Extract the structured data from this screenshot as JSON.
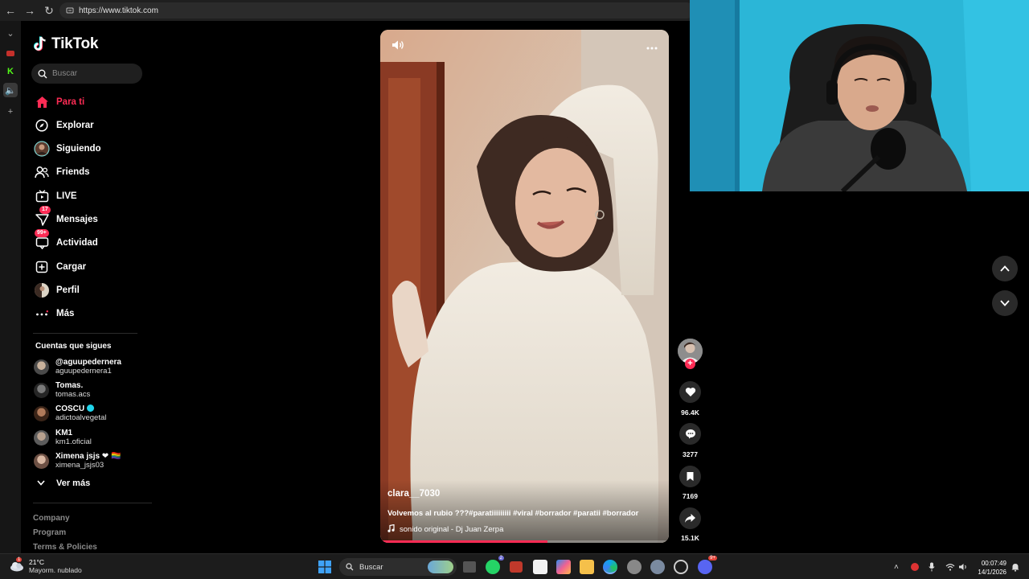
{
  "browser": {
    "url": "https://www.tiktok.com"
  },
  "sidebar": {
    "logo_text": "TikTok",
    "search_placeholder": "Buscar",
    "nav": [
      {
        "label": "Para ti",
        "icon": "home-icon",
        "active": true
      },
      {
        "label": "Explorar",
        "icon": "compass-icon"
      },
      {
        "label": "Siguiendo",
        "icon": "avatar-icon"
      },
      {
        "label": "Friends",
        "icon": "friends-icon"
      },
      {
        "label": "LIVE",
        "icon": "live-icon"
      },
      {
        "label": "Mensajes",
        "icon": "messages-icon",
        "badge": "17"
      },
      {
        "label": "Actividad",
        "icon": "activity-icon",
        "badge": "99+"
      },
      {
        "label": "Cargar",
        "icon": "upload-icon"
      },
      {
        "label": "Perfil",
        "icon": "profile-icon"
      },
      {
        "label": "Más",
        "icon": "more-icon"
      }
    ],
    "following_title": "Cuentas que sigues",
    "following": [
      {
        "name": "@aguupedernera",
        "username": "aguupedernera1"
      },
      {
        "name": "Tomas.",
        "username": "tomas.acs"
      },
      {
        "name": "COSCU",
        "username": "adictoalvegetal",
        "verified": true
      },
      {
        "name": "KM1",
        "username": "km1.oficial"
      },
      {
        "name": "Ximena jsjs ❤ 🏳️‍🌈",
        "username": "ximena_jsjs03"
      }
    ],
    "see_more": "Ver más",
    "footer": [
      "Company",
      "Program",
      "Terms & Policies"
    ]
  },
  "video": {
    "username": "clara__7030",
    "description": "Volvemos al rubio ???#paratiiiiiiiii #viral #borrador #paratii #borrador",
    "sound": "sonido original - Dj Juan Zerpa",
    "progress": 0.58
  },
  "actions": {
    "likes": "96.4K",
    "comments": "3277",
    "saves": "7169",
    "shares": "15.1K"
  },
  "taskbar": {
    "temperature": "21°C",
    "weather": "Mayorm. nublado",
    "search": "Buscar",
    "time": "00:07:49",
    "date": "14/1/2026",
    "whatsapp_badge": "2",
    "discord_badge": "9+",
    "weather_badge": "1"
  },
  "colors": {
    "accent": "#fe2c55",
    "background": "#000000",
    "webcam_wall": "#2ab7d8"
  }
}
